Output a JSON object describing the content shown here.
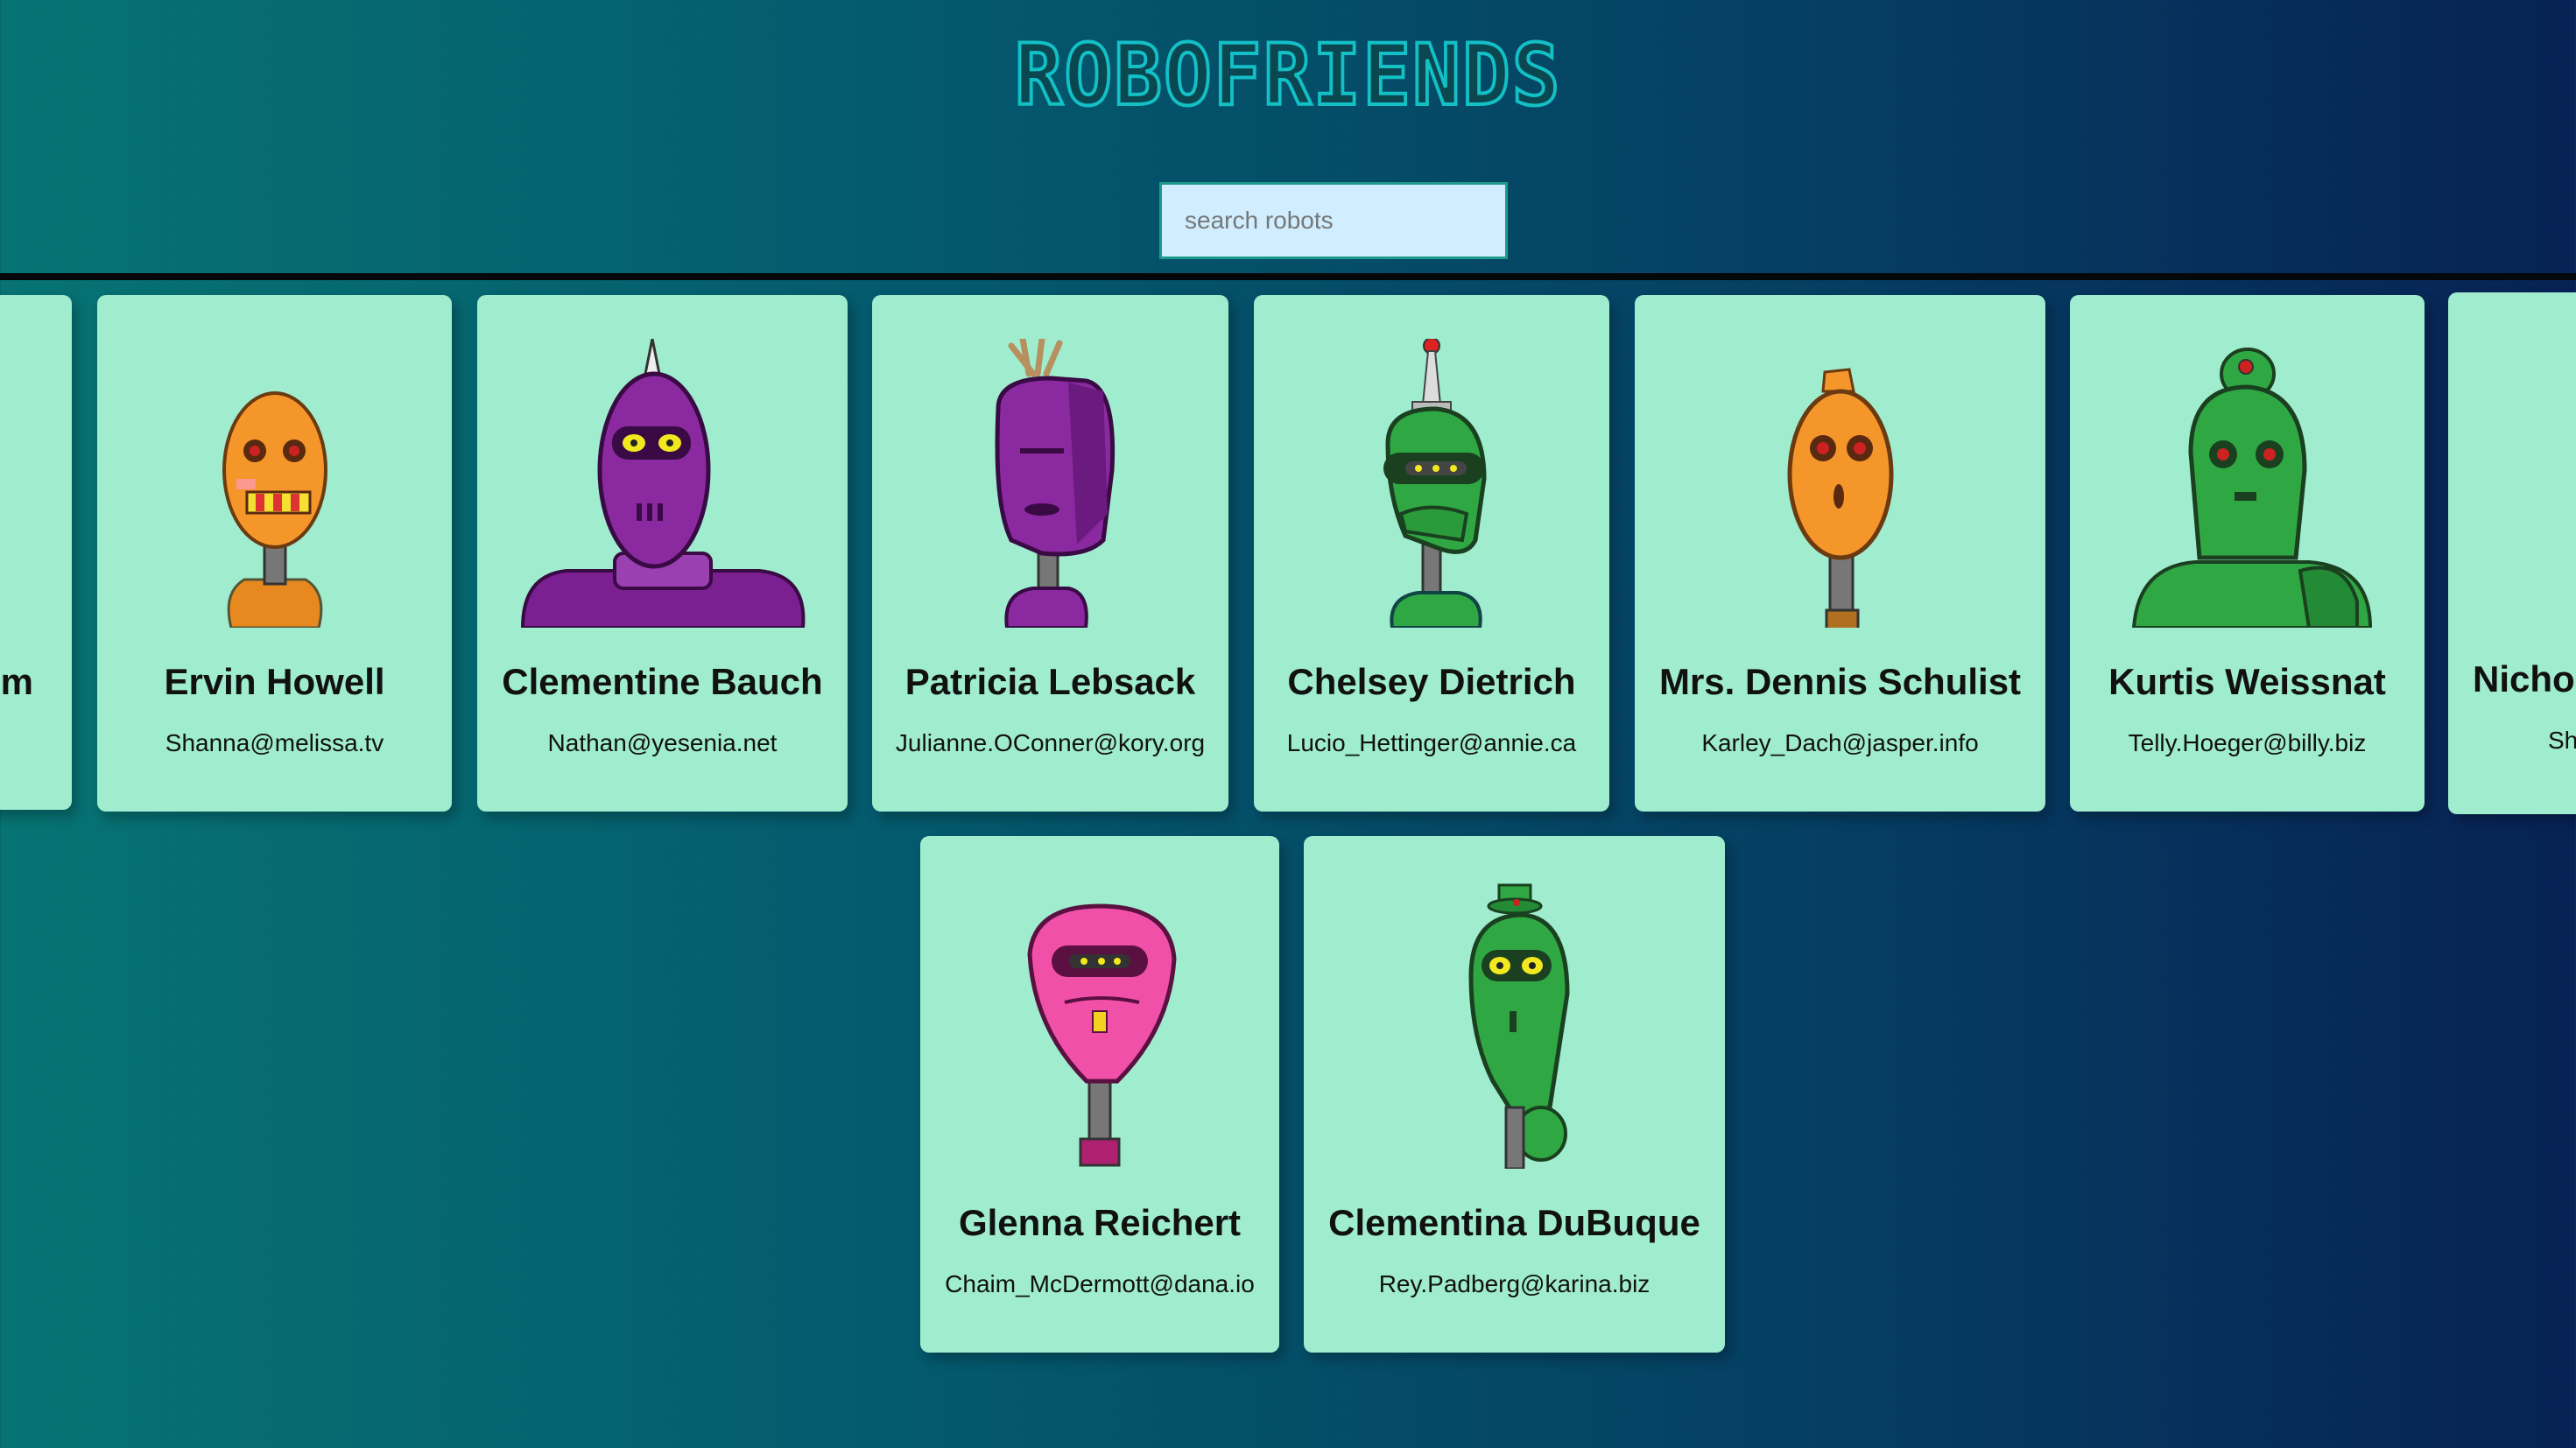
{
  "header": {
    "logo_text": "ROBOFRIENDS"
  },
  "search": {
    "placeholder": "search robots",
    "value": ""
  },
  "cards": [
    {
      "name": "m",
      "email": ""
    },
    {
      "name": "Ervin Howell",
      "email": "Shanna@melissa.tv"
    },
    {
      "name": "Clementine Bauch",
      "email": "Nathan@yesenia.net"
    },
    {
      "name": "Patricia Lebsack",
      "email": "Julianne.OConner@kory.org"
    },
    {
      "name": "Chelsey Dietrich",
      "email": "Lucio_Hettinger@annie.ca"
    },
    {
      "name": "Mrs. Dennis Schulist",
      "email": "Karley_Dach@jasper.info"
    },
    {
      "name": "Kurtis Weissnat",
      "email": "Telly.Hoeger@billy.biz"
    },
    {
      "name": "Nicho",
      "email": "Sh"
    },
    {
      "name": "Glenna Reichert",
      "email": "Chaim_McDermott@dana.io"
    },
    {
      "name": "Clementina DuBuque",
      "email": "Rey.Padberg@karina.biz"
    }
  ],
  "colors": {
    "card_bg": "#9feccf",
    "logo_stroke": "#12c0c6",
    "search_bg": "#d0eeff",
    "orange_robot": "#f5962a",
    "purple_robot": "#8b2aa0",
    "green_robot": "#2fa844",
    "pink_robot": "#f050a8"
  },
  "icons": [
    "orange-robot-icon",
    "purple-robot-icon",
    "green-robot-icon",
    "pink-robot-icon"
  ]
}
